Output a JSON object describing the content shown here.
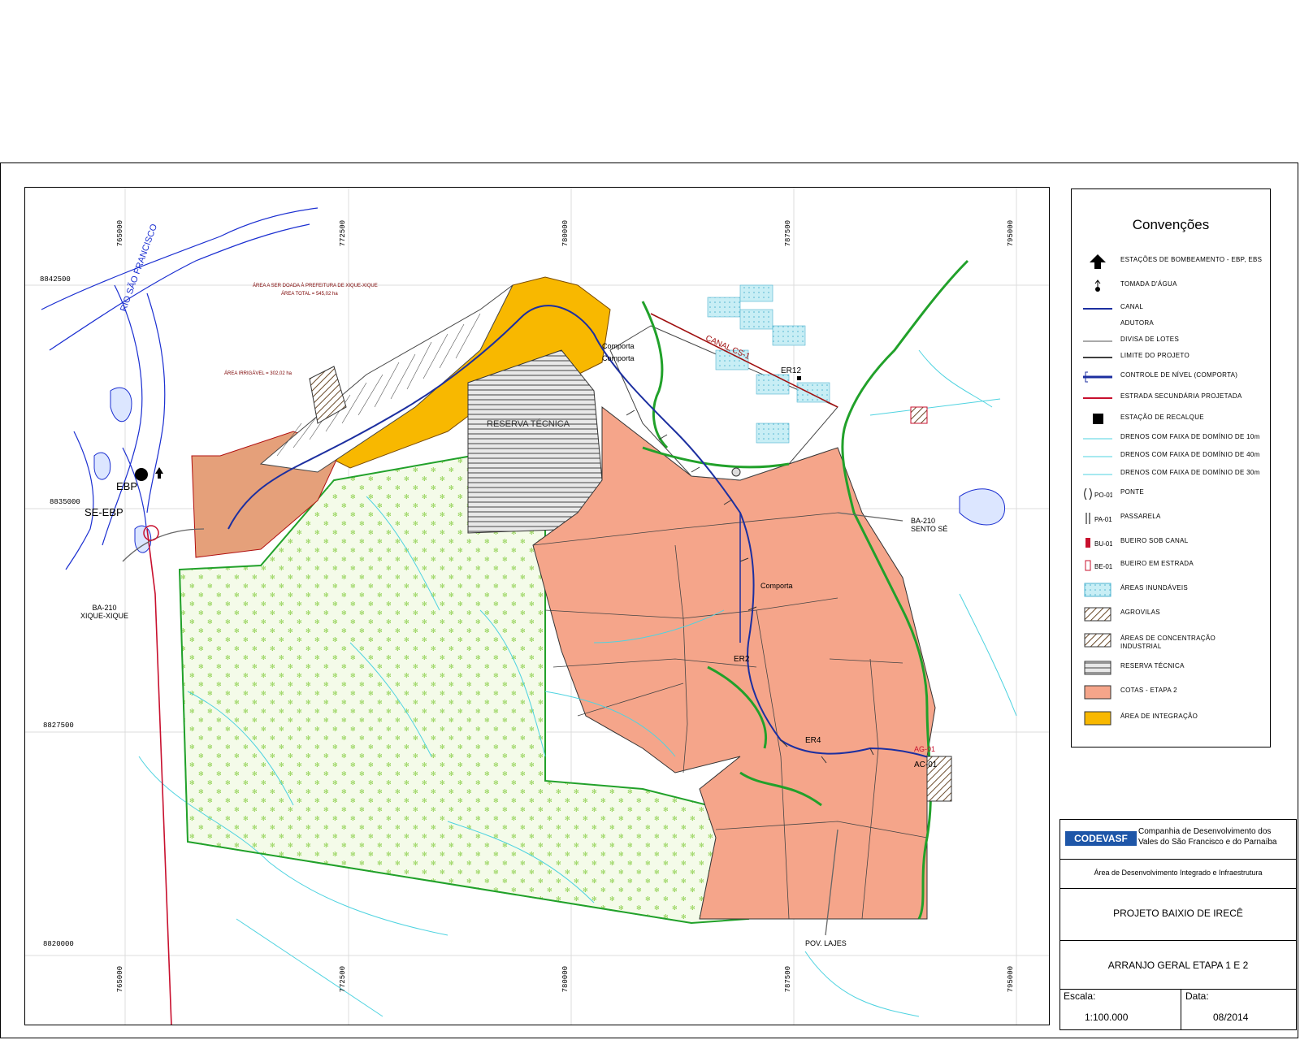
{
  "colors": {
    "parcel_fill": "#f5a58a",
    "integration_fill": "#f8b800",
    "reserve_fill": "#eaf5d8",
    "reserve_glyph": "#8fd14f",
    "canal": "#1c2fa0",
    "drain": "#4fd3e0",
    "river": "#1b2fd1",
    "boundary_green": "#21a12a",
    "road_red": "#c8102e",
    "flood_area": "#a8e3ef"
  },
  "map": {
    "coords_x": [
      "765000",
      "772500",
      "780000",
      "787500",
      "795000"
    ],
    "coords_y": [
      "8842500",
      "8835000",
      "8827500",
      "8820000"
    ],
    "labels": {
      "rio": "RIO SÃO FRANCISCO",
      "ebp": "EBP",
      "se_ebp": "SE-EBP",
      "ba210_xique": [
        "BA-210",
        "XIQUE-XIQUE"
      ],
      "ba210_sento": [
        "BA-210",
        "SENTO SÉ"
      ],
      "pov_lajes": "POV. LAJES",
      "canal_cs1": "CANAL CS-1",
      "er12": "ER12",
      "er2": "ER2",
      "er4": "ER4",
      "comporta_1": "Comporta",
      "comporta_2": "Comporta",
      "comporta_3": "Comporta",
      "ac1": "AC-01",
      "ag1": "AG-01",
      "area_prefeitura": "ÁREA A SER DOADA À PREFEITURA DE XIQUE-XIQUE",
      "area_total": "ÁREA TOTAL = 545,02 ha",
      "area_irrigavel": "ÁREA IRRIGÁVEL = 302,02 ha",
      "reserva": "RESERVA TÉCNICA"
    }
  },
  "legend": {
    "title": "Convenções",
    "items": [
      {
        "label": "ESTAÇÕES DE BOMBEAMENTO - EBP, EBS",
        "icon": "pump-station-icon"
      },
      {
        "label": "TOMADA D'ÁGUA",
        "icon": "water-intake-icon"
      },
      {
        "label": "CANAL",
        "icon": "canal-line"
      },
      {
        "label": "ADUTORA",
        "icon": "pipeline-line"
      },
      {
        "label": "DIVISA DE LOTES",
        "icon": "lot-line"
      },
      {
        "label": "LIMITE DO PROJETO",
        "icon": "limit-line"
      },
      {
        "label": "CONTROLE DE NÍVEL (COMPORTA)",
        "icon": "gate-line"
      },
      {
        "label": "ESTRADA SECUNDÁRIA PROJETADA",
        "icon": "road-line"
      },
      {
        "label": "ESTAÇÃO DE RECALQUE",
        "icon": "square-icon"
      },
      {
        "label": "DRENOS COM FAIXA DE DOMÍNIO DE 10m",
        "icon": "drain-10"
      },
      {
        "label": "DRENOS COM FAIXA DE DOMÍNIO DE 40m",
        "icon": "drain-40"
      },
      {
        "label": "DRENOS COM FAIXA DE DOMÍNIO DE 30m",
        "icon": "drain-30"
      },
      {
        "label": "PONTE",
        "code": "PO-01",
        "icon": "bridge-icon"
      },
      {
        "label": "PASSARELA",
        "code": "PA-01",
        "icon": "footbridge-icon"
      },
      {
        "label": "BUEIRO SOB CANAL",
        "code": "BU-01",
        "icon": "culvert-canal-icon"
      },
      {
        "label": "BUEIRO EM ESTRADA",
        "code": "BE-01",
        "icon": "culvert-road-icon"
      },
      {
        "label": "ÁREAS INUNDÁVEIS",
        "icon": "flood-swatch"
      },
      {
        "label": "AGROVILAS",
        "icon": "agrovila-swatch"
      },
      {
        "label": "ÁREAS DE CONCENTRAÇÃO INDUSTRIAL",
        "icon": "industrial-swatch"
      },
      {
        "label": "RESERVA TÉCNICA",
        "icon": "reserve-swatch"
      },
      {
        "label": "COTAS - ETAPA 2",
        "icon": "stage2-swatch"
      },
      {
        "label": "ÁREA DE INTEGRAÇÃO",
        "icon": "integration-swatch"
      }
    ]
  },
  "title_block": {
    "logo": "CODEVASF",
    "company_line1": "Companhia de Desenvolvimento dos",
    "company_line2": "Vales do São Francisco e do Parnaíba",
    "department": "Área de Desenvolvimento Integrado e Infraestrutura",
    "project": "PROJETO BAIXIO DE IRECÊ",
    "drawing": "ARRANJO GERAL ETAPA 1 E 2",
    "scale_label": "Escala:",
    "scale_value": "1:100.000",
    "date_label": "Data:",
    "date_value": "08/2014"
  }
}
